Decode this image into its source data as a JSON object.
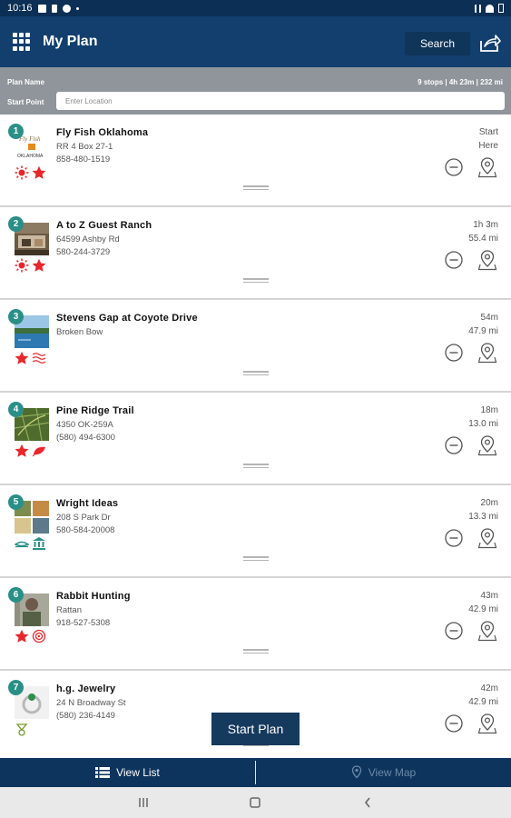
{
  "status_bar": {
    "time": "10:16"
  },
  "header": {
    "title": "My Plan",
    "search_label": "Search",
    "menu_icon": "grid-menu-icon",
    "share_icon": "share-icon"
  },
  "plan": {
    "name_label": "Plan Name",
    "summary": "9 stops | 4h 23m | 232 mi",
    "start_point_label": "Start Point",
    "start_point_placeholder": "Enter Location"
  },
  "stops": [
    {
      "number": "1",
      "name": "Fly Fish Oklahoma",
      "line1": "RR 4 Box 27-1",
      "line2": "858-480-1519",
      "time": "Start",
      "distance": "Here",
      "icons": [
        "sun-icon",
        "star-icon"
      ]
    },
    {
      "number": "2",
      "name": "A to Z Guest Ranch",
      "line1": "64599 Ashby Rd",
      "line2": "580-244-3729",
      "time": "1h 3m",
      "distance": "55.4 mi",
      "icons": [
        "sun-icon",
        "star-icon"
      ]
    },
    {
      "number": "3",
      "name": "Stevens Gap at Coyote Drive",
      "line1": "Broken Bow",
      "line2": "",
      "time": "54m",
      "distance": "47.9 mi",
      "icons": [
        "star-icon",
        "waves-icon"
      ]
    },
    {
      "number": "4",
      "name": "Pine Ridge Trail",
      "line1": "4350 OK-259A",
      "line2": "(580) 494-6300",
      "time": "18m",
      "distance": "13.0 mi",
      "icons": [
        "star-icon",
        "leaf-icon"
      ]
    },
    {
      "number": "5",
      "name": "Wright Ideas",
      "line1": "208 S Park Dr",
      "line2": "580-584-20008",
      "time": "20m",
      "distance": "13.3 mi",
      "icons": [
        "shop-icon",
        "museum-icon"
      ]
    },
    {
      "number": "6",
      "name": "Rabbit Hunting",
      "line1": "Rattan",
      "line2": "918-527-5308",
      "time": "43m",
      "distance": "42.9 mi",
      "icons": [
        "star-icon",
        "target-icon"
      ]
    },
    {
      "number": "7",
      "name": "h.g. Jewelry",
      "line1": "24 N Broadway St",
      "line2": "(580) 236-4149",
      "time": "42m",
      "distance": "42.9 mi",
      "icons": [
        "ring-icon"
      ]
    }
  ],
  "actions": {
    "start_plan": "Start Plan"
  },
  "tabs": {
    "view_list": "View List",
    "view_map": "View Map"
  },
  "colors": {
    "header": "#123f6e",
    "status_bar": "#0c2f55",
    "badge": "#2a8f87",
    "star": "#e8262b",
    "plan_info": "#8f959a",
    "tab_bar": "#0d345c"
  }
}
